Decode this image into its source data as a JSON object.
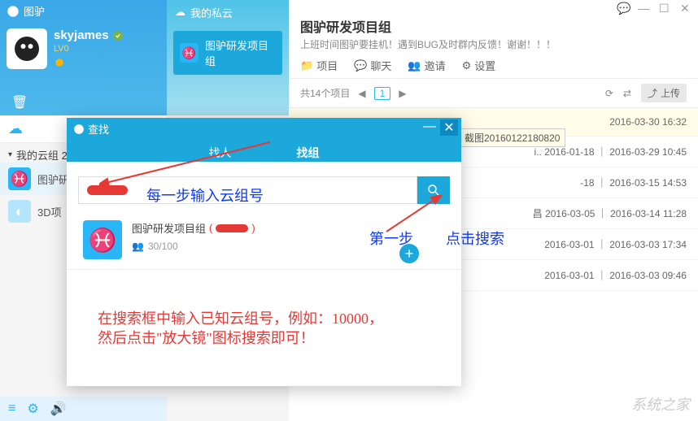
{
  "app": {
    "name": "图驴"
  },
  "user": {
    "name": "skyjames",
    "level": "LV0"
  },
  "private_cloud": {
    "header": "我的私云",
    "item": "图驴研发项目组"
  },
  "main_header": {
    "title": "图驴研发项目组",
    "subtitle": "上班时间图驴要挂机！遇到BUG及时群内反馈！谢谢！！！",
    "tab_project": "项目",
    "tab_chat": "聊天",
    "tab_invite": "邀请",
    "tab_settings": "设置",
    "count": "共14个项目",
    "page": "1",
    "upload": "上传"
  },
  "tooltip": "截图20160122180820",
  "sidebar": {
    "mygroup_label": "我的云组 2",
    "items": [
      {
        "label": "图驴研"
      },
      {
        "label": "3D项"
      }
    ]
  },
  "files": [
    {
      "dates": "2016-03-30 16:32"
    },
    {
      "meta": "i..  2016-01-18 ｜ 2016-03-29 10:45"
    },
    {
      "meta": "-18 ｜ 2016-03-15 14:53"
    },
    {
      "meta": "昌  2016-03-05 ｜ 2016-03-14 11:28"
    },
    {
      "meta": "2016-03-01 ｜ 2016-03-03 17:34"
    },
    {
      "meta": "2016-03-01 ｜ 2016-03-03 09:46"
    }
  ],
  "dialog": {
    "title": "查找",
    "tab_person": "找人",
    "tab_group": "找组",
    "result_name": "图驴研发项目组",
    "members": "30/100"
  },
  "annotations": {
    "step_input": "每一步输入云组号",
    "step_click_a": "第一步",
    "step_click_b": "点击搜索",
    "help1": "在搜索框中输入已知云组号，例如：10000，",
    "help2": "然后点击\"放大镜\"图标搜索即可！"
  },
  "watermark": "系统之家"
}
